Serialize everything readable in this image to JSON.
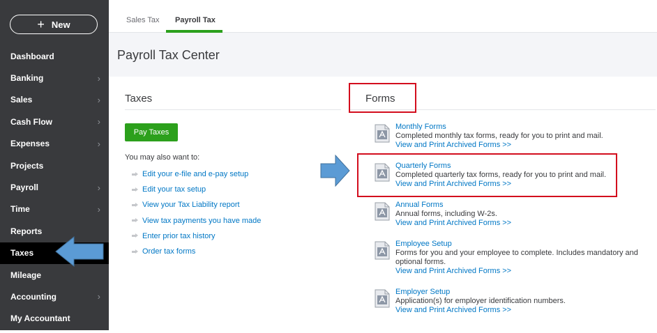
{
  "sidebar": {
    "new_label": "New",
    "items": [
      {
        "label": "Dashboard",
        "chevron": false,
        "active": false
      },
      {
        "label": "Banking",
        "chevron": true,
        "active": false
      },
      {
        "label": "Sales",
        "chevron": true,
        "active": false
      },
      {
        "label": "Cash Flow",
        "chevron": true,
        "active": false
      },
      {
        "label": "Expenses",
        "chevron": true,
        "active": false
      },
      {
        "label": "Projects",
        "chevron": false,
        "active": false
      },
      {
        "label": "Payroll",
        "chevron": true,
        "active": false
      },
      {
        "label": "Time",
        "chevron": true,
        "active": false
      },
      {
        "label": "Reports",
        "chevron": false,
        "active": false
      },
      {
        "label": "Taxes",
        "chevron": true,
        "active": true
      },
      {
        "label": "Mileage",
        "chevron": false,
        "active": false
      },
      {
        "label": "Accounting",
        "chevron": true,
        "active": false
      },
      {
        "label": "My Accountant",
        "chevron": false,
        "active": false
      }
    ]
  },
  "tabs": [
    {
      "label": "Sales Tax",
      "active": false
    },
    {
      "label": "Payroll Tax",
      "active": true
    }
  ],
  "page_title": "Payroll Tax Center",
  "taxes": {
    "title": "Taxes",
    "pay_button": "Pay Taxes",
    "also_label": "You may also want to:",
    "links": [
      "Edit your e-file and e-pay setup",
      "Edit your tax setup",
      "View your Tax Liability report",
      "View tax payments you have made",
      "Enter prior tax history",
      "Order tax forms"
    ]
  },
  "forms": {
    "title": "Forms",
    "items": [
      {
        "name": "Monthly Forms",
        "desc": "Completed monthly tax forms, ready for you to print and mail.",
        "link": "View and Print Archived Forms >>"
      },
      {
        "name": "Quarterly Forms",
        "desc": "Completed quarterly tax forms, ready for you to print and mail.",
        "link": "View and Print Archived Forms >>"
      },
      {
        "name": "Annual Forms",
        "desc": "Annual forms, including W-2s.",
        "link": "View and Print Archived Forms >>"
      },
      {
        "name": "Employee Setup",
        "desc": "Forms for you and your employee to complete. Includes mandatory and optional forms.",
        "link": "View and Print Archived Forms >>"
      },
      {
        "name": "Employer Setup",
        "desc": "Application(s) for employer identification numbers.",
        "link": "View and Print Archived Forms >>"
      }
    ]
  },
  "colors": {
    "sidebar_bg": "#393a3d",
    "active_bg": "#000000",
    "accent_green": "#2ca01c",
    "link_blue": "#0077c5",
    "highlight_red": "#d30d1d",
    "callout_arrow_blue": "#5b9bd5"
  }
}
